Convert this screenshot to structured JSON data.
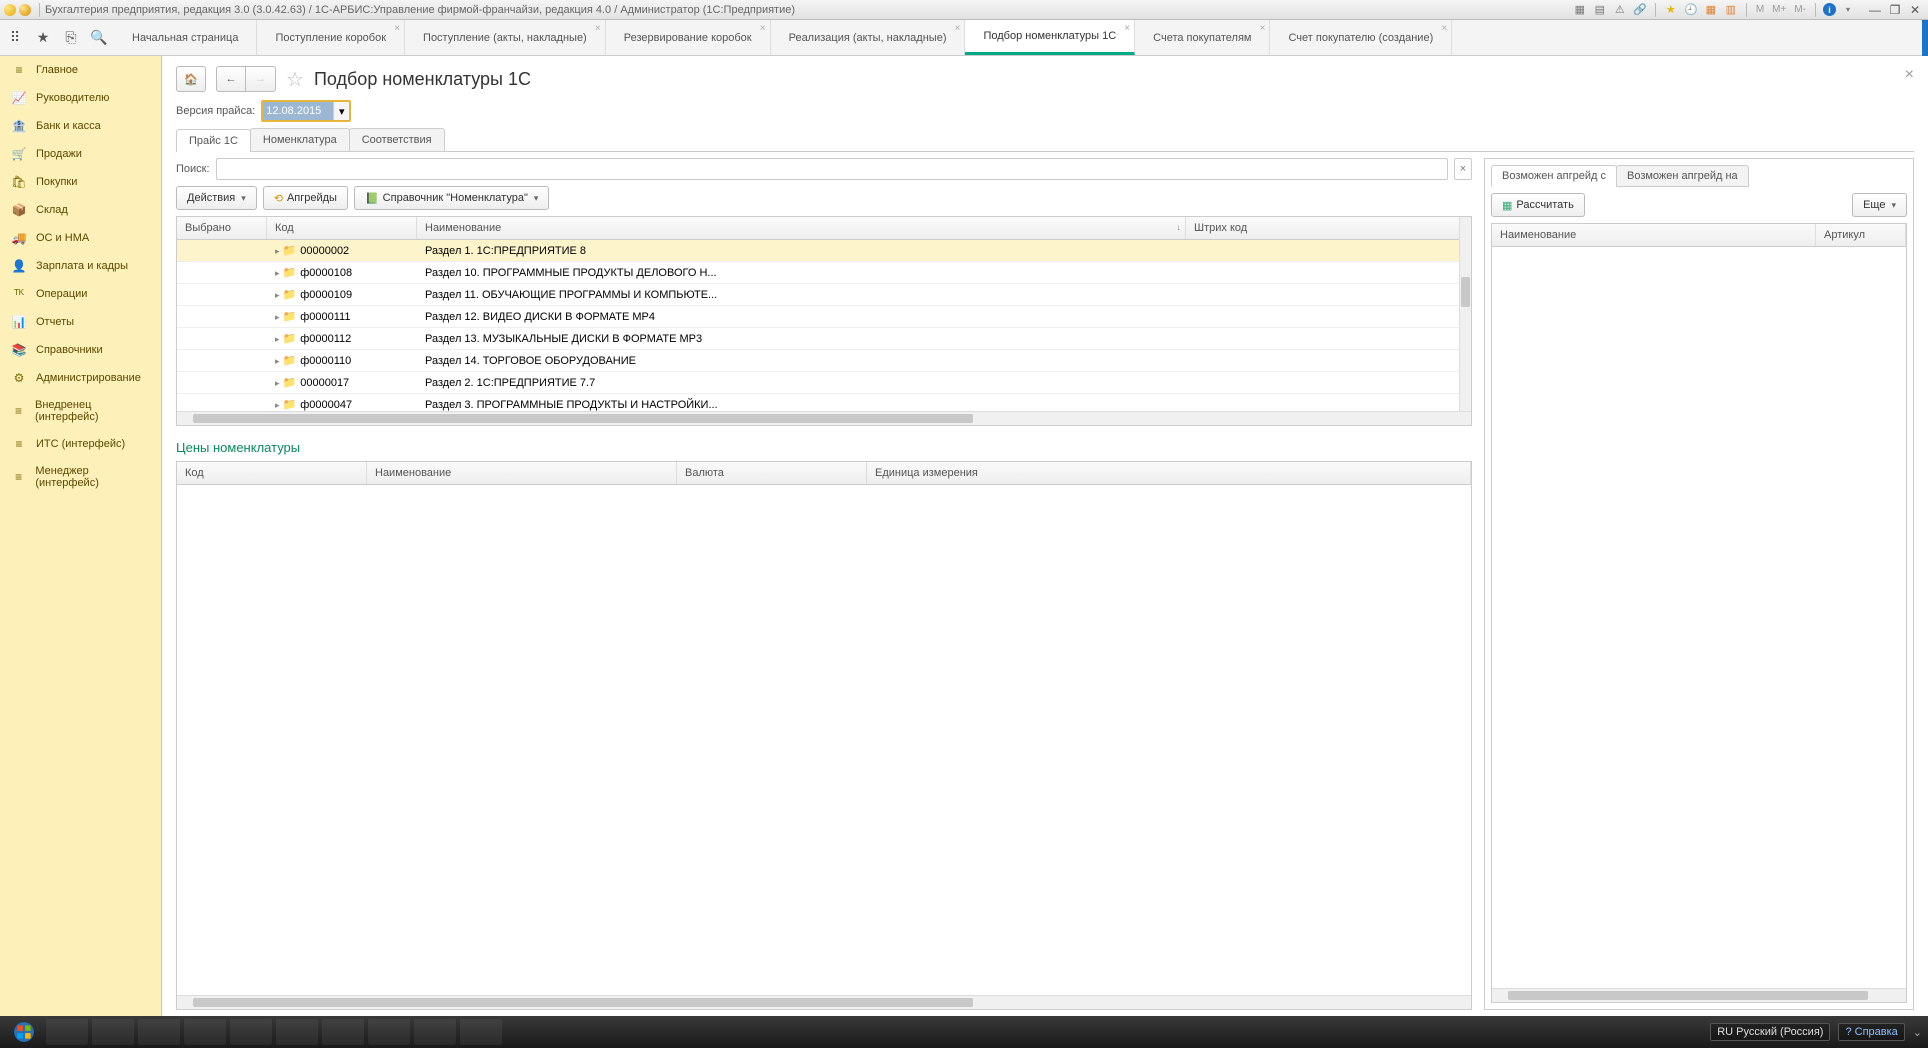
{
  "titlebar": {
    "text": "Бухгалтерия предприятия, редакция 3.0 (3.0.42.63) / 1С-АРБИС:Управление фирмой-франчайзи, редакция 4.0 / Администратор  (1С:Предприятие)",
    "m_labels": [
      "M",
      "M+",
      "M-"
    ]
  },
  "top_tabs": [
    {
      "label": "Начальная страница",
      "closable": false
    },
    {
      "label": "Поступление коробок",
      "closable": true
    },
    {
      "label": "Поступление (акты, накладные)",
      "closable": true
    },
    {
      "label": "Резервирование коробок",
      "closable": true
    },
    {
      "label": "Реализация (акты, накладные)",
      "closable": true
    },
    {
      "label": "Подбор номенклатуры 1С",
      "closable": true,
      "active": true
    },
    {
      "label": "Счета покупателям",
      "closable": true
    },
    {
      "label": "Счет покупателю (создание)",
      "closable": true
    }
  ],
  "sidebar": [
    {
      "icon": "≡",
      "label": "Главное"
    },
    {
      "icon": "📈",
      "label": "Руководителю"
    },
    {
      "icon": "🏦",
      "label": "Банк и касса"
    },
    {
      "icon": "🛒",
      "label": "Продажи"
    },
    {
      "icon": "🛍",
      "label": "Покупки"
    },
    {
      "icon": "📦",
      "label": "Склад"
    },
    {
      "icon": "🚚",
      "label": "ОС и НМА"
    },
    {
      "icon": "👤",
      "label": "Зарплата и кадры"
    },
    {
      "icon": "ᵀᴷ",
      "label": "Операции"
    },
    {
      "icon": "📊",
      "label": "Отчеты"
    },
    {
      "icon": "📚",
      "label": "Справочники"
    },
    {
      "icon": "⚙",
      "label": "Администрирование"
    },
    {
      "icon": "≡",
      "label": "Внедренец (интерфейс)"
    },
    {
      "icon": "≡",
      "label": "ИТС (интерфейс)"
    },
    {
      "icon": "≡",
      "label": "Менеджер (интерфейс)"
    }
  ],
  "page": {
    "title": "Подбор номенклатуры 1С",
    "version_label": "Версия прайса:",
    "version_value": "12.08.2015"
  },
  "subtabs": [
    {
      "label": "Прайс 1С",
      "active": true
    },
    {
      "label": "Номенклатура"
    },
    {
      "label": "Соответствия"
    }
  ],
  "search_label": "Поиск:",
  "actions_btn": "Действия",
  "upgrades_btn": "Апгрейды",
  "ref_btn": "Справочник \"Номенклатура\"",
  "table1": {
    "headers": {
      "sel": "Выбрано",
      "code": "Код",
      "name": "Наименование",
      "barcode": "Штрих код"
    },
    "rows": [
      {
        "code": "00000002",
        "name": "Раздел 1. 1С:ПРЕДПРИЯТИЕ 8",
        "selected": true
      },
      {
        "code": "ф0000108",
        "name": "Раздел 10. ПРОГРАММНЫЕ ПРОДУКТЫ ДЕЛОВОГО Н..."
      },
      {
        "code": "ф0000109",
        "name": "Раздел 11. ОБУЧАЮЩИЕ ПРОГРАММЫ И КОМПЬЮТЕ..."
      },
      {
        "code": "ф0000111",
        "name": "Раздел 12. ВИДЕО ДИСКИ В ФОРМАТЕ  MP4"
      },
      {
        "code": "ф0000112",
        "name": "Раздел 13. МУЗЫКАЛЬНЫЕ  ДИСКИ В ФОРМАТЕ  MP3"
      },
      {
        "code": "ф0000110",
        "name": "Раздел 14. ТОРГОВОЕ ОБОРУДОВАНИЕ"
      },
      {
        "code": "00000017",
        "name": "Раздел 2. 1С:ПРЕДПРИЯТИЕ 7.7"
      },
      {
        "code": "ф0000047",
        "name": "Раздел 3. ПРОГРАММНЫЕ ПРОДУКТЫ И НАСТРОЙКИ..."
      }
    ]
  },
  "prices_title": "Цены номенклатуры",
  "table2": {
    "headers": {
      "code": "Код",
      "name": "Наименование",
      "currency": "Валюта",
      "unit": "Единица измерения"
    }
  },
  "right": {
    "tabs": [
      {
        "label": "Возможен апгрейд с",
        "active": true
      },
      {
        "label": "Возможен апгрейд на"
      }
    ],
    "calc_btn": "Рассчитать",
    "more_btn": "Еще",
    "headers": {
      "name": "Наименование",
      "article": "Артикул"
    }
  },
  "taskbar": {
    "lang": "RU Русский (Россия)",
    "help": "? Справка"
  }
}
